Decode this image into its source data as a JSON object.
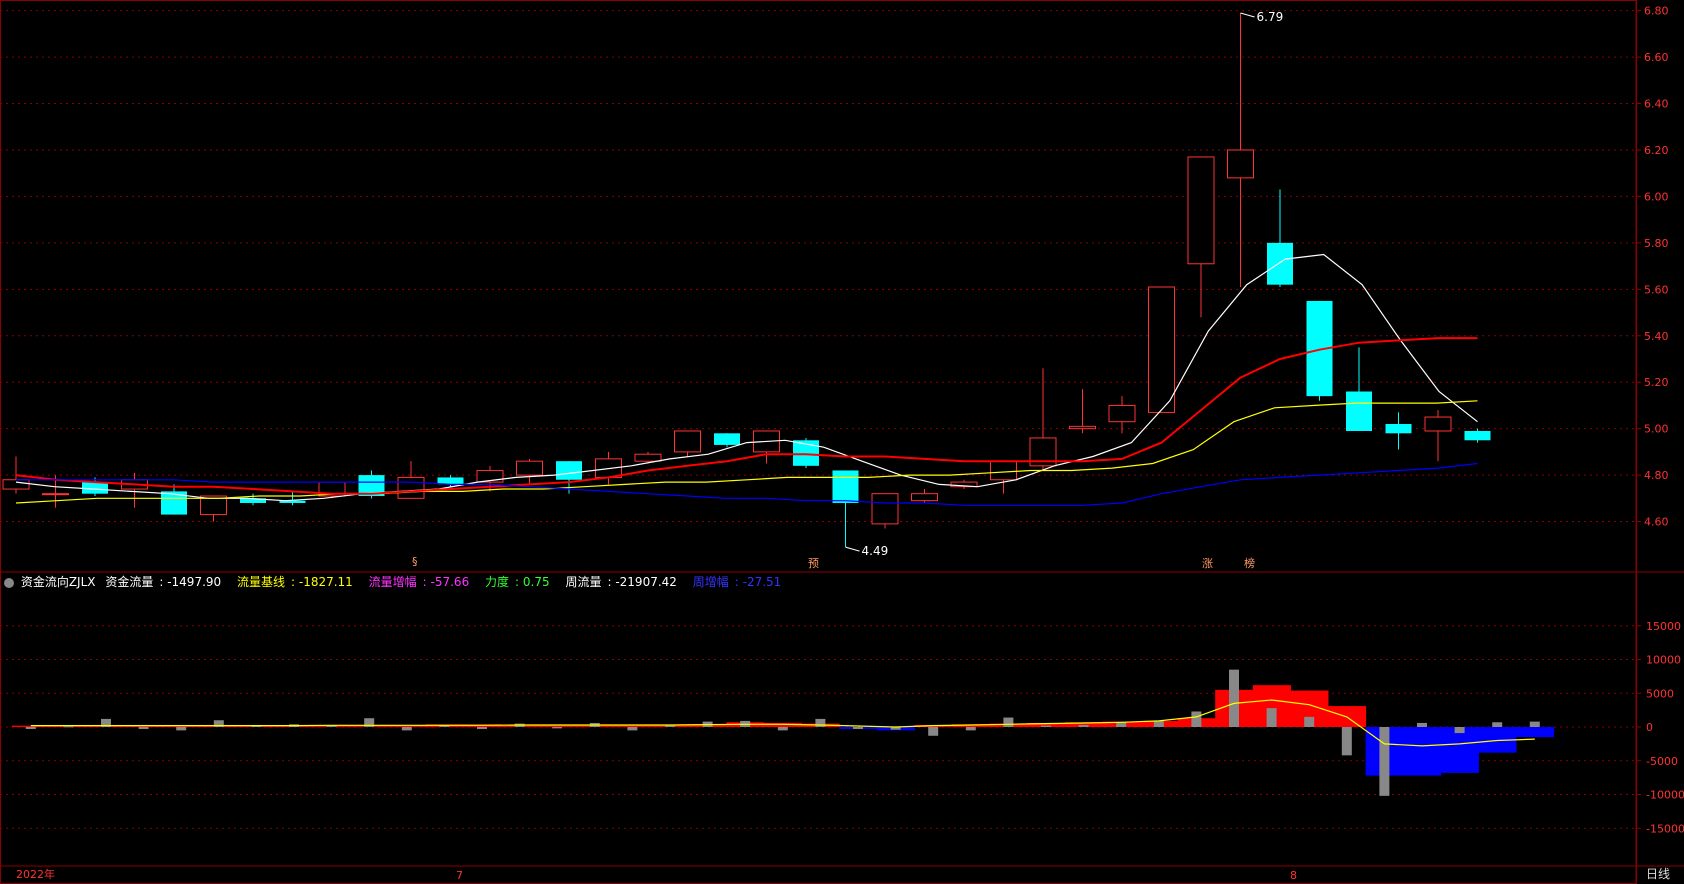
{
  "legend": {
    "indicator_name": "资金流向ZJLX",
    "items": [
      {
        "label": "资金流量",
        "value": "-1497.90",
        "color": "#ffffff"
      },
      {
        "label": "流量基线",
        "value": "-1827.11",
        "color": "#ffff00"
      },
      {
        "label": "流量增幅",
        "value": "-57.66",
        "color": "#ff33ff"
      },
      {
        "label": "力度",
        "value": "0.75",
        "color": "#33ff33"
      },
      {
        "label": "周流量",
        "value": "-21907.42",
        "color": "#ffffff"
      },
      {
        "label": "周增幅",
        "value": "-27.51",
        "color": "#3333ff"
      }
    ]
  },
  "period": "日线",
  "date_labels": [
    {
      "text": "2022年"
    },
    {
      "text": "7"
    },
    {
      "text": "8"
    }
  ],
  "markers": [
    {
      "text": "§"
    },
    {
      "text": "预"
    },
    {
      "text": "涨"
    },
    {
      "text": "榜"
    }
  ],
  "colors": {
    "up": "#ff3333",
    "down": "#00ffff",
    "ma5": "#ffffff",
    "ma10": "#ffff00",
    "ma20": "#ff0000",
    "ma60": "#0000ff",
    "grid": "#8b0000"
  },
  "chart_data": [
    {
      "type": "candlestick",
      "ylim": [
        4.4,
        6.82
      ],
      "y_ticks": [
        4.6,
        4.8,
        5.0,
        5.2,
        5.4,
        5.6,
        5.8,
        6.0,
        6.2,
        6.4,
        6.6,
        6.8
      ],
      "y_tick_labels": [
        "4.60",
        "4.80",
        "5.00",
        "5.20",
        "5.40",
        "5.60",
        "5.80",
        "6.00",
        "6.20",
        "6.40",
        "6.60",
        "6.80"
      ],
      "annotations": [
        {
          "text": "6.79",
          "index": 31,
          "value": 6.79
        },
        {
          "text": "4.49",
          "index": 21,
          "value": 4.49
        }
      ],
      "ohlc": [
        [
          4.74,
          4.88,
          4.72,
          4.78
        ],
        [
          4.72,
          4.8,
          4.66,
          4.72
        ],
        [
          4.77,
          4.79,
          4.71,
          4.72
        ],
        [
          4.74,
          4.81,
          4.66,
          4.78
        ],
        [
          4.73,
          4.76,
          4.63,
          4.63
        ],
        [
          4.63,
          4.69,
          4.6,
          4.71
        ],
        [
          4.7,
          4.72,
          4.67,
          4.68
        ],
        [
          4.69,
          4.73,
          4.67,
          4.68
        ],
        [
          4.71,
          4.77,
          4.7,
          4.77
        ],
        [
          4.8,
          4.82,
          4.7,
          4.71
        ],
        [
          4.7,
          4.86,
          4.7,
          4.79
        ],
        [
          4.79,
          4.8,
          4.75,
          4.76
        ],
        [
          4.77,
          4.84,
          4.73,
          4.82
        ],
        [
          4.8,
          4.87,
          4.76,
          4.86
        ],
        [
          4.86,
          4.86,
          4.72,
          4.78
        ],
        [
          4.79,
          4.9,
          4.76,
          4.87
        ],
        [
          4.86,
          4.9,
          4.85,
          4.89
        ],
        [
          4.9,
          4.99,
          4.88,
          4.99
        ],
        [
          4.98,
          4.98,
          4.92,
          4.93
        ],
        [
          4.9,
          4.99,
          4.85,
          4.99
        ],
        [
          4.95,
          4.96,
          4.83,
          4.84
        ],
        [
          4.82,
          4.82,
          4.49,
          4.68
        ],
        [
          4.59,
          4.72,
          4.57,
          4.72
        ],
        [
          4.69,
          4.74,
          4.68,
          4.72
        ],
        [
          4.75,
          4.78,
          4.74,
          4.77
        ],
        [
          4.78,
          4.81,
          4.72,
          4.86
        ],
        [
          4.84,
          5.26,
          4.82,
          4.96
        ],
        [
          5.0,
          5.17,
          4.98,
          5.01
        ],
        [
          5.03,
          5.14,
          4.98,
          5.1
        ],
        [
          5.07,
          5.61,
          5.07,
          5.61
        ],
        [
          5.71,
          6.17,
          5.48,
          6.17
        ],
        [
          6.08,
          6.79,
          5.61,
          6.2
        ],
        [
          5.8,
          6.03,
          5.61,
          5.62
        ],
        [
          5.55,
          5.55,
          5.12,
          5.14
        ],
        [
          5.16,
          5.35,
          4.99,
          4.99
        ],
        [
          5.02,
          5.07,
          4.91,
          4.98
        ],
        [
          4.99,
          5.08,
          4.86,
          5.05
        ],
        [
          4.99,
          5.0,
          4.94,
          4.95
        ]
      ],
      "series": [
        {
          "name": "MA5",
          "values": [
            4.77,
            4.75,
            4.74,
            4.73,
            4.72,
            4.7,
            4.7,
            4.69,
            4.7,
            4.72,
            4.73,
            4.74,
            4.77,
            4.79,
            4.8,
            4.82,
            4.84,
            4.87,
            4.89,
            4.94,
            4.95,
            4.92,
            4.86,
            4.8,
            4.76,
            4.75,
            4.78,
            4.84,
            4.88,
            4.94,
            5.12,
            5.42,
            5.62,
            5.73,
            5.75,
            5.62,
            5.38,
            5.16,
            5.03
          ]
        },
        {
          "name": "MA10",
          "values": [
            4.68,
            4.69,
            4.7,
            4.7,
            4.7,
            4.7,
            4.71,
            4.71,
            4.72,
            4.72,
            4.73,
            4.73,
            4.74,
            4.74,
            4.75,
            4.76,
            4.77,
            4.77,
            4.78,
            4.79,
            4.79,
            4.79,
            4.8,
            4.8,
            4.81,
            4.82,
            4.82,
            4.83,
            4.85,
            4.91,
            5.03,
            5.09,
            5.1,
            5.11,
            5.11,
            5.11,
            5.12
          ]
        },
        {
          "name": "MA20",
          "values": [
            4.8,
            4.78,
            4.77,
            4.76,
            4.75,
            4.75,
            4.74,
            4.73,
            4.72,
            4.72,
            4.73,
            4.74,
            4.75,
            4.76,
            4.77,
            4.79,
            4.82,
            4.84,
            4.86,
            4.89,
            4.89,
            4.88,
            4.88,
            4.87,
            4.86,
            4.86,
            4.86,
            4.86,
            4.87,
            4.94,
            5.08,
            5.22,
            5.3,
            5.34,
            5.37,
            5.38,
            5.39,
            5.39
          ]
        },
        {
          "name": "MA60",
          "values": [
            4.78,
            4.78,
            4.78,
            4.78,
            4.78,
            4.77,
            4.77,
            4.77,
            4.77,
            4.77,
            4.77,
            4.76,
            4.76,
            4.75,
            4.74,
            4.73,
            4.72,
            4.71,
            4.7,
            4.7,
            4.69,
            4.69,
            4.68,
            4.68,
            4.67,
            4.67,
            4.67,
            4.67,
            4.68,
            4.72,
            4.75,
            4.78,
            4.79,
            4.8,
            4.81,
            4.82,
            4.83,
            4.85
          ]
        }
      ]
    },
    {
      "type": "bar",
      "ylim": [
        -20000,
        20000
      ],
      "y_ticks": [
        15000,
        10000,
        5000,
        0,
        -5000,
        -10000,
        -15000
      ],
      "y_tick_labels": [
        "15000",
        "10000",
        "5000",
        "0",
        "-5000",
        "-10000",
        "-15000"
      ],
      "series": [
        {
          "name": "周流量",
          "values": [
            200,
            200,
            300,
            300,
            300,
            300,
            200,
            200,
            300,
            300,
            300,
            400,
            400,
            300,
            300,
            300,
            300,
            300,
            400,
            700,
            600,
            500,
            -300,
            -500,
            300,
            400,
            500,
            600,
            700,
            800,
            900,
            1300,
            5500,
            6200,
            5400,
            3100,
            -7200,
            -7200,
            -6800,
            -3800,
            -1500
          ]
        },
        {
          "name": "资金流量",
          "values": [
            -300,
            100,
            1200,
            -300,
            -500,
            1000,
            300,
            400,
            300,
            1300,
            -500,
            200,
            -300,
            500,
            -200,
            600,
            -500,
            200,
            800,
            900,
            -500,
            1200,
            -300,
            -400,
            -1300,
            -500,
            1400,
            200,
            300,
            700,
            900,
            2300,
            8500,
            2800,
            1500,
            -4200,
            -10200,
            600,
            -900,
            700,
            800
          ]
        },
        {
          "name": "流量基线",
          "values": [
            200,
            200,
            200,
            200,
            200,
            200,
            200,
            200,
            250,
            250,
            250,
            250,
            250,
            300,
            300,
            300,
            300,
            300,
            350,
            400,
            400,
            300,
            150,
            0,
            200,
            300,
            400,
            500,
            600,
            700,
            900,
            1500,
            3500,
            4000,
            3300,
            1500,
            -2500,
            -2800,
            -2500,
            -2000,
            -1800
          ]
        }
      ]
    }
  ]
}
